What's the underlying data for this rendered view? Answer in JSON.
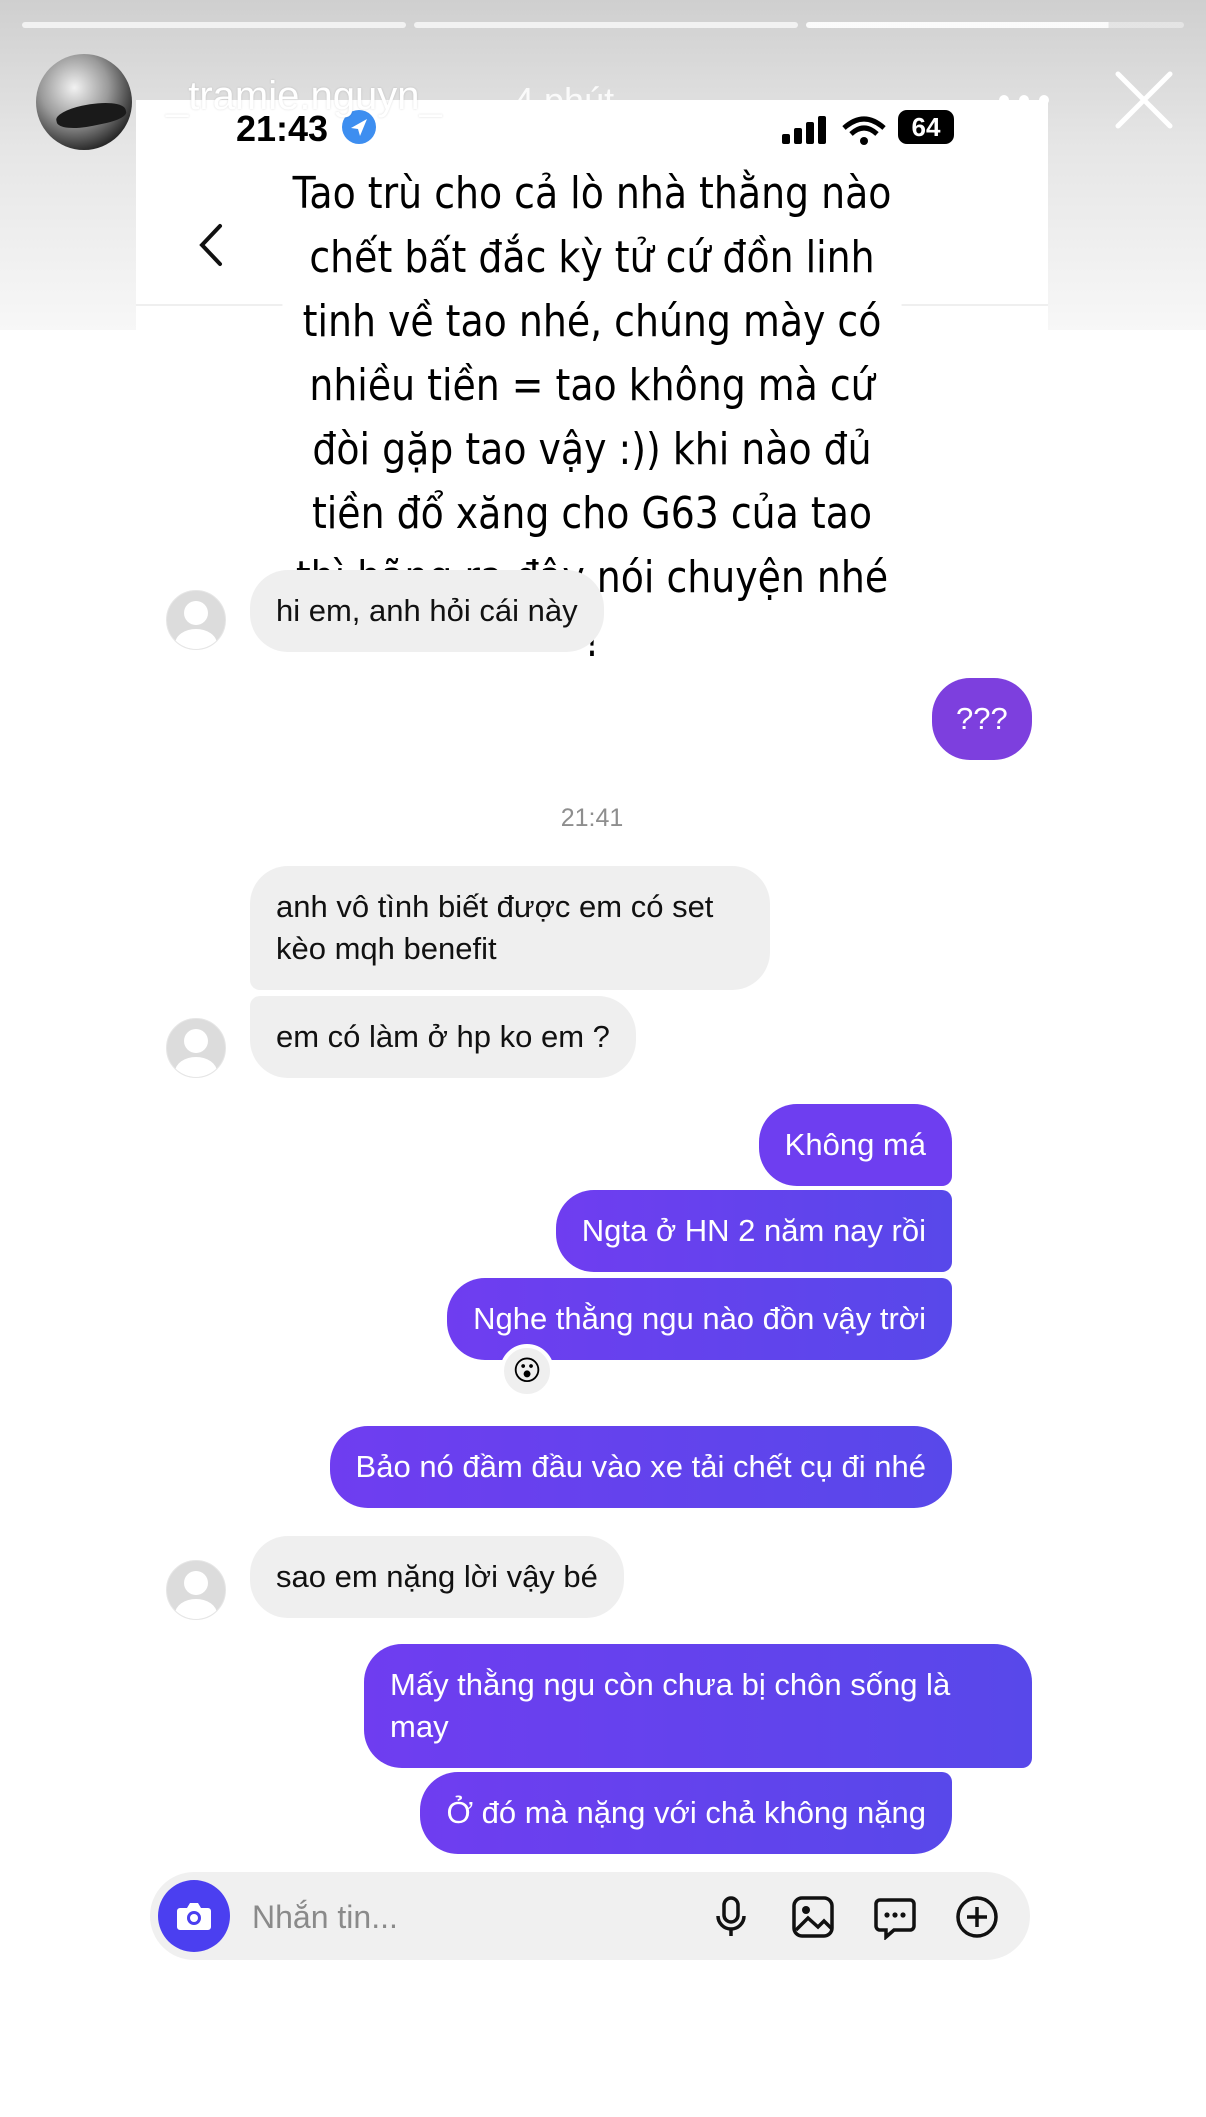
{
  "story": {
    "username": "_tramie.nguyn_",
    "time_ago": "4 phút"
  },
  "status_bar": {
    "time": "21:43",
    "battery": "64"
  },
  "overlay_text": "Tao trù cho cả lò nhà thằng nào chết bất đắc kỳ tử cứ đồn linh tinh về tao nhé, chúng mày có nhiều tiền = tao không mà cứ đòi gặp tao vậy :)) khi nào đủ tiền đổ xăng cho G63 của tao thì hãng ra đây nói chuyện nhé !",
  "chat": {
    "messages": [
      {
        "from": "them",
        "text": "hi em, anh hỏi cái này"
      },
      {
        "from": "me",
        "text": "???"
      },
      {
        "from": "them",
        "text": "anh vô tình biết được em có set kèo mqh benefit"
      },
      {
        "from": "them",
        "text": "em có làm ở hp ko em ?"
      },
      {
        "from": "me",
        "text": "Không má"
      },
      {
        "from": "me",
        "text": "Ngta ở HN 2 năm nay rồi"
      },
      {
        "from": "me",
        "text": "Nghe thằng ngu nào đồn vậy trời"
      },
      {
        "from": "me",
        "text": "Bảo nó đầm đầu vào xe tải chết cụ đi nhé"
      },
      {
        "from": "them",
        "text": "sao em nặng lời vậy bé"
      },
      {
        "from": "me",
        "text": "Mấy thằng ngu còn chưa bị chôn sống là may"
      },
      {
        "from": "me",
        "text": "Ở đó mà nặng với chả không nặng"
      }
    ],
    "timestamp": "21:41",
    "reaction": "😮"
  },
  "composer": {
    "placeholder": "Nhắn tin..."
  },
  "colors": {
    "outgoing_bubble": "#5f46ee",
    "outgoing_bubble_purple": "#7d3fde",
    "incoming_bubble": "#efefef",
    "camera_button": "#4b3ff0",
    "verified_badge": "#3d8ef0"
  },
  "icons": [
    "more-icon",
    "close-icon",
    "back-icon",
    "verified-icon",
    "signal-icon",
    "wifi-icon",
    "camera-icon",
    "microphone-icon",
    "image-icon",
    "sticker-icon",
    "plus-icon"
  ]
}
